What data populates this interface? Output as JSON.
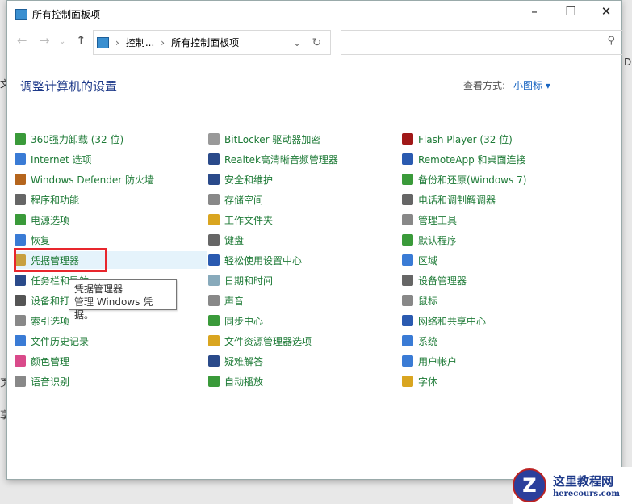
{
  "window": {
    "title": "所有控制面板项",
    "minimize": "–",
    "maximize": "☐",
    "close": "✕"
  },
  "address": {
    "crumbs": [
      "控制...",
      "所有控制面板项"
    ],
    "sep": "›",
    "dropdown": "⌄",
    "refresh": "↻",
    "search_placeholder": "",
    "search_icon": "⚲"
  },
  "nav": {
    "back": "←",
    "forward": "→",
    "recent": "⌄",
    "up": "↑"
  },
  "heading": "调整计算机的设置",
  "view": {
    "label": "查看方式:",
    "value": "小图标 ▾"
  },
  "columns": [
    [
      {
        "label": "360强力卸载 (32 位)",
        "color": "#3a9a3a"
      },
      {
        "label": "Internet 选项",
        "color": "#3a7bd5"
      },
      {
        "label": "Windows Defender 防火墙",
        "color": "#b5651d"
      },
      {
        "label": "程序和功能",
        "color": "#666"
      },
      {
        "label": "电源选项",
        "color": "#3a9a3a"
      },
      {
        "label": "恢复",
        "color": "#3a7bd5"
      },
      {
        "label": "凭据管理器",
        "color": "#c8a040"
      },
      {
        "label": "任务栏和导航",
        "color": "#2a4a8a"
      },
      {
        "label": "设备和打印机",
        "color": "#555"
      },
      {
        "label": "索引选项",
        "color": "#888"
      },
      {
        "label": "文件历史记录",
        "color": "#3a7bd5"
      },
      {
        "label": "颜色管理",
        "color": "#d94a8a"
      },
      {
        "label": "语音识别",
        "color": "#888"
      }
    ],
    [
      {
        "label": "BitLocker 驱动器加密",
        "color": "#999"
      },
      {
        "label": "Realtek高清晰音频管理器",
        "color": "#2a4a8a"
      },
      {
        "label": "安全和维护",
        "color": "#2a4a8a"
      },
      {
        "label": "存储空间",
        "color": "#888"
      },
      {
        "label": "工作文件夹",
        "color": "#d9a520"
      },
      {
        "label": "键盘",
        "color": "#666"
      },
      {
        "label": "轻松使用设置中心",
        "color": "#2a5ab0"
      },
      {
        "label": "日期和时间",
        "color": "#8ab"
      },
      {
        "label": "声音",
        "color": "#888"
      },
      {
        "label": "同步中心",
        "color": "#3a9a3a"
      },
      {
        "label": "文件资源管理器选项",
        "color": "#d9a520"
      },
      {
        "label": "疑难解答",
        "color": "#2a4a8a"
      },
      {
        "label": "自动播放",
        "color": "#3a9a3a"
      }
    ],
    [
      {
        "label": "Flash Player (32 位)",
        "color": "#a01818"
      },
      {
        "label": "RemoteApp 和桌面连接",
        "color": "#2a5ab0"
      },
      {
        "label": "备份和还原(Windows 7)",
        "color": "#3a9a3a"
      },
      {
        "label": "电话和调制解调器",
        "color": "#666"
      },
      {
        "label": "管理工具",
        "color": "#888"
      },
      {
        "label": "默认程序",
        "color": "#3a9a3a"
      },
      {
        "label": "区域",
        "color": "#3a7bd5"
      },
      {
        "label": "设备管理器",
        "color": "#666"
      },
      {
        "label": "鼠标",
        "color": "#888"
      },
      {
        "label": "网络和共享中心",
        "color": "#2a5ab0"
      },
      {
        "label": "系统",
        "color": "#3a7bd5"
      },
      {
        "label": "用户帐户",
        "color": "#3a7bd5"
      },
      {
        "label": "字体",
        "color": "#d9a520"
      }
    ]
  ],
  "tooltip": {
    "title": "凭据管理器",
    "desc": "管理 Windows 凭据。"
  },
  "watermark": {
    "letter": "Z",
    "name": "这里教程网",
    "url": "herecours.com"
  }
}
